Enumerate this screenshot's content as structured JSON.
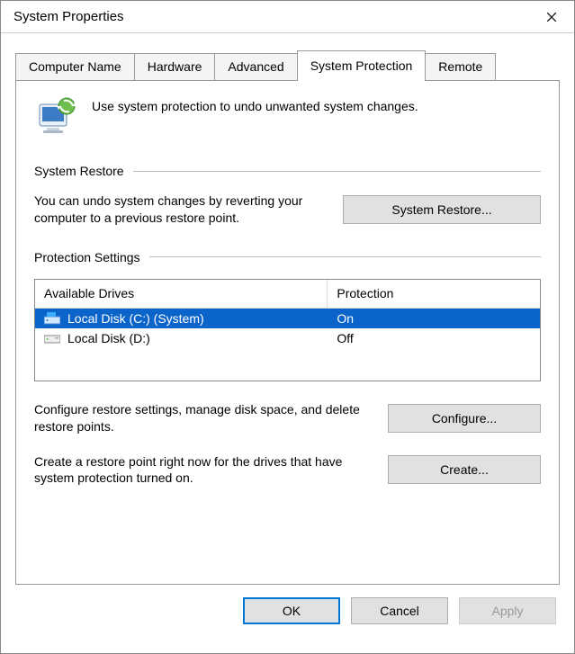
{
  "window": {
    "title": "System Properties"
  },
  "tabs": [
    {
      "label": "Computer Name"
    },
    {
      "label": "Hardware"
    },
    {
      "label": "Advanced"
    },
    {
      "label": "System Protection"
    },
    {
      "label": "Remote"
    }
  ],
  "active_tab_index": 3,
  "intro_text": "Use system protection to undo unwanted system changes.",
  "groups": {
    "restore": {
      "title": "System Restore",
      "desc": "You can undo system changes by reverting your computer to a previous restore point.",
      "button": "System Restore..."
    },
    "protection": {
      "title": "Protection Settings",
      "columns": {
        "drives": "Available Drives",
        "protection": "Protection"
      },
      "rows": [
        {
          "name": "Local Disk (C:) (System)",
          "protection": "On",
          "selected": true,
          "icon": "drive-system-icon"
        },
        {
          "name": "Local Disk (D:)",
          "protection": "Off",
          "selected": false,
          "icon": "drive-icon"
        }
      ],
      "configure": {
        "desc": "Configure restore settings, manage disk space, and delete restore points.",
        "button": "Configure..."
      },
      "create": {
        "desc": "Create a restore point right now for the drives that have system protection turned on.",
        "button": "Create..."
      }
    }
  },
  "buttons": {
    "ok": "OK",
    "cancel": "Cancel",
    "apply": "Apply"
  }
}
